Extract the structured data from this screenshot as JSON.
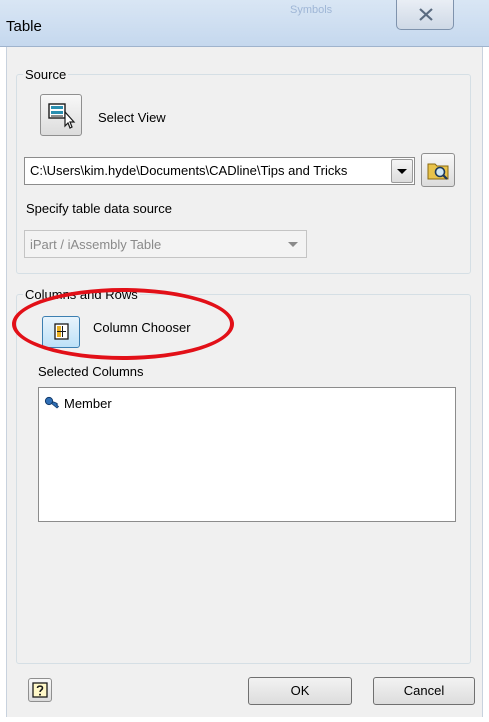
{
  "window": {
    "title": "Table",
    "background_title": "Symbols"
  },
  "source": {
    "group_label": "Source",
    "select_view_label": "Select View",
    "path_value": "C:\\Users\\kim.hyde\\Documents\\CADline\\Tips and Tricks",
    "specify_label": "Specify table data source",
    "data_source_value": "iPart / iAssembly Table"
  },
  "columns": {
    "group_label": "Columns and Rows",
    "column_chooser_label": "Column Chooser",
    "selected_columns_label": "Selected Columns",
    "items": [
      {
        "label": "Member"
      }
    ]
  },
  "footer": {
    "ok_label": "OK",
    "cancel_label": "Cancel"
  },
  "colors": {
    "annotation": "#e21018",
    "accent": "#3c7fb1"
  }
}
